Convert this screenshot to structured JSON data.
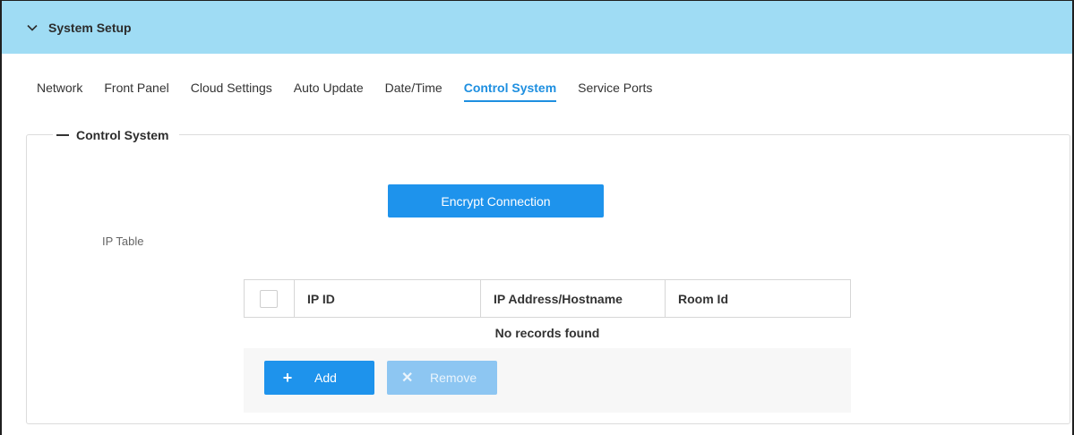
{
  "header": {
    "title": "System Setup",
    "toggle_icon": "chevron-down-icon"
  },
  "tabs": [
    {
      "label": "Network",
      "active": false
    },
    {
      "label": "Front Panel",
      "active": false
    },
    {
      "label": "Cloud Settings",
      "active": false
    },
    {
      "label": "Auto Update",
      "active": false
    },
    {
      "label": "Date/Time",
      "active": false
    },
    {
      "label": "Control System",
      "active": true
    },
    {
      "label": "Service Ports",
      "active": false
    }
  ],
  "section": {
    "title": "Control System",
    "collapse_icon": "minus-icon"
  },
  "encrypt_button": {
    "label": "Encrypt Connection"
  },
  "ip_table": {
    "label": "IP Table",
    "columns": [
      "IP ID",
      "IP Address/Hostname",
      "Room Id"
    ],
    "empty_text": "No records found",
    "add_label": "Add",
    "remove_label": "Remove"
  },
  "colors": {
    "header_bg": "#9fdcf4",
    "accent": "#1e93ec",
    "active_tab": "#1e8fe0",
    "disabled_button": "#8dc6f2"
  }
}
